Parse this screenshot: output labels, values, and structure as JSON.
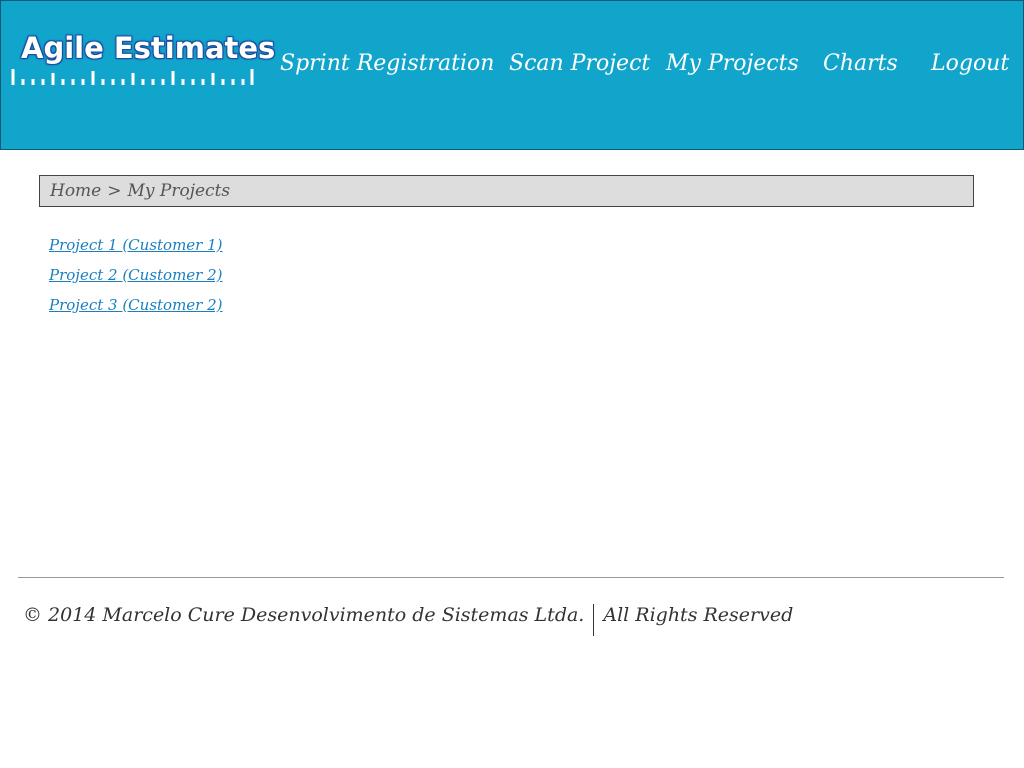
{
  "app": {
    "logo_text": "Agile Estimates"
  },
  "nav": {
    "items": [
      {
        "label": "Sprint Registration"
      },
      {
        "label": "Scan Project"
      },
      {
        "label": "My Projects"
      },
      {
        "label": "Charts"
      },
      {
        "label": "Logout"
      }
    ]
  },
  "breadcrumb": {
    "home": "Home",
    "separator": ">",
    "current": "My Projects"
  },
  "projects": [
    {
      "label": "Project 1 (Customer 1)"
    },
    {
      "label": "Project 2 (Customer 2)"
    },
    {
      "label": "Project 3 (Customer 2)"
    }
  ],
  "footer": {
    "copyright": "© 2014 Marcelo Cure Desenvolvimento de Sistemas Ltda.",
    "rights": "All Rights Reserved"
  },
  "colors": {
    "header_bg": "#12a5cc",
    "link": "#1a7fc1",
    "breadcrumb_bg": "#dddddd"
  }
}
